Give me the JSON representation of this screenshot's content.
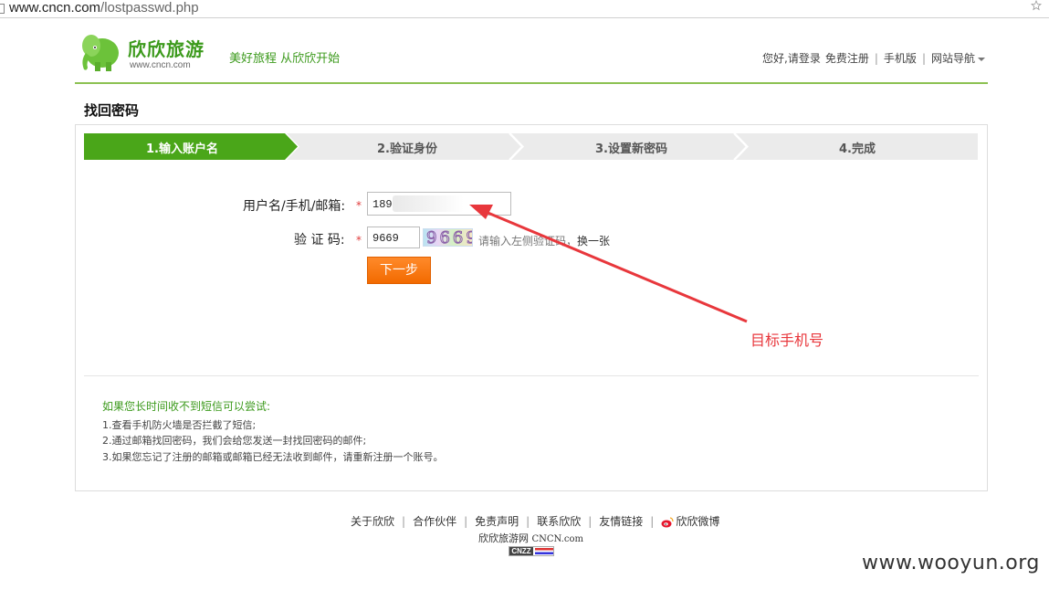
{
  "browser": {
    "url_host": "www.cncn.com",
    "url_path": "/lostpasswd.php"
  },
  "header": {
    "brand_name": "欣欣旅游",
    "brand_domain": "www.cncn.com",
    "slogan": "美好旅程 从欣欣开始",
    "nav": {
      "greeting": "您好, ",
      "login": "请登录",
      "register": "免费注册",
      "mobile": "手机版",
      "site_nav": "网站导航"
    }
  },
  "page_title": "找回密码",
  "steps": [
    {
      "label": "1.输入账户名",
      "active": true
    },
    {
      "label": "2.验证身份",
      "active": false
    },
    {
      "label": "3.设置新密码",
      "active": false
    },
    {
      "label": "4.完成",
      "active": false
    }
  ],
  "form": {
    "username_label": "用户名/手机/邮箱:",
    "username_value": "189",
    "captcha_label": "验 证 码:",
    "captcha_value": "9669",
    "captcha_image_text": "9669",
    "captcha_hint": "请输入左侧验证码，",
    "captcha_refresh": "换一张",
    "required_mark": "*",
    "next_button": "下一步"
  },
  "annotation": {
    "label": "目标手机号",
    "color": "#e8373c"
  },
  "tips": {
    "title": "如果您长时间收不到短信可以尝试:",
    "items": [
      "1.查看手机防火墙是否拦截了短信;",
      "2.通过邮箱找回密码，我们会给您发送一封找回密码的邮件;",
      "3.如果您忘记了注册的邮箱或邮箱已经无法收到邮件，请重新注册一个账号。"
    ]
  },
  "footer": {
    "links": [
      "关于欣欣",
      "合作伙伴",
      "免责声明",
      "联系欣欣",
      "友情链接",
      "欣欣微博"
    ],
    "site_name": "欣欣旅游网",
    "site_domain": "CNCN.com",
    "badge": "CNZZ"
  },
  "watermark": "www.wooyun.org",
  "colors": {
    "brand_green": "#3c9a1c",
    "active_step": "#4aa619",
    "button_orange": "#f26a00"
  }
}
